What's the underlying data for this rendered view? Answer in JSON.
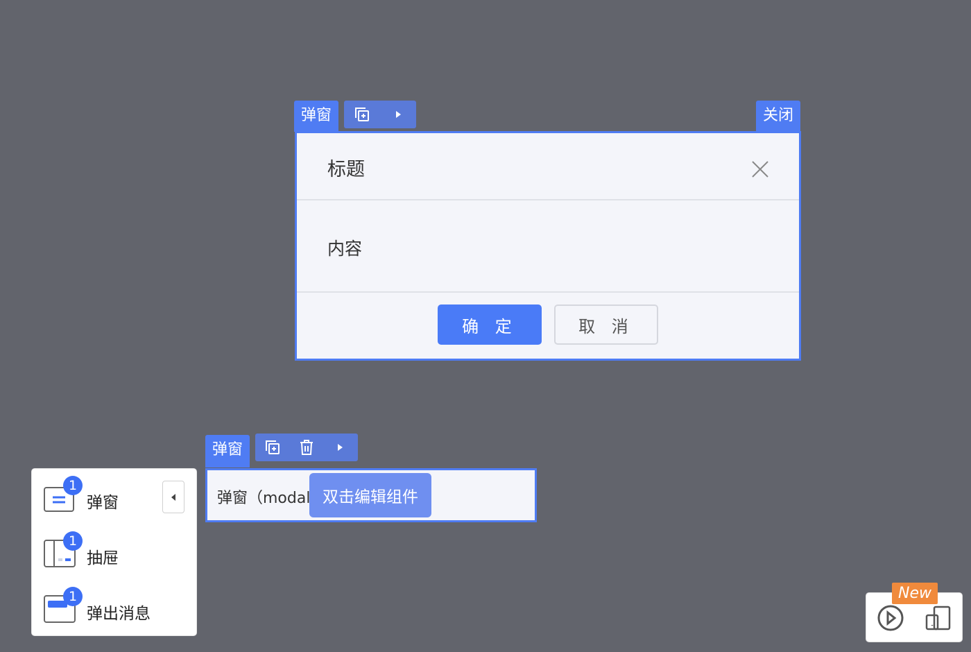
{
  "modal": {
    "tag_label": "弹窗",
    "close_tag_label": "关闭",
    "title": "标题",
    "content": "内容",
    "confirm_label": "确 定",
    "cancel_label": "取 消"
  },
  "card": {
    "tag_label": "弹窗",
    "text": "弹窗（modal_",
    "hint": "双击编辑组件"
  },
  "panel": {
    "items": [
      {
        "label": "弹窗",
        "badge": "1",
        "icon": "modal-icon"
      },
      {
        "label": "抽屉",
        "badge": "1",
        "icon": "drawer-icon"
      },
      {
        "label": "弹出消息",
        "badge": "1",
        "icon": "message-icon"
      }
    ]
  },
  "widget": {
    "new_label": "New",
    "icons": [
      "play-circle-icon",
      "device-icon"
    ]
  },
  "colors": {
    "background": "#62646c",
    "accent": "#4f7cf3",
    "primary_button": "#4a7bf7",
    "new_tag": "#f08a3c"
  }
}
